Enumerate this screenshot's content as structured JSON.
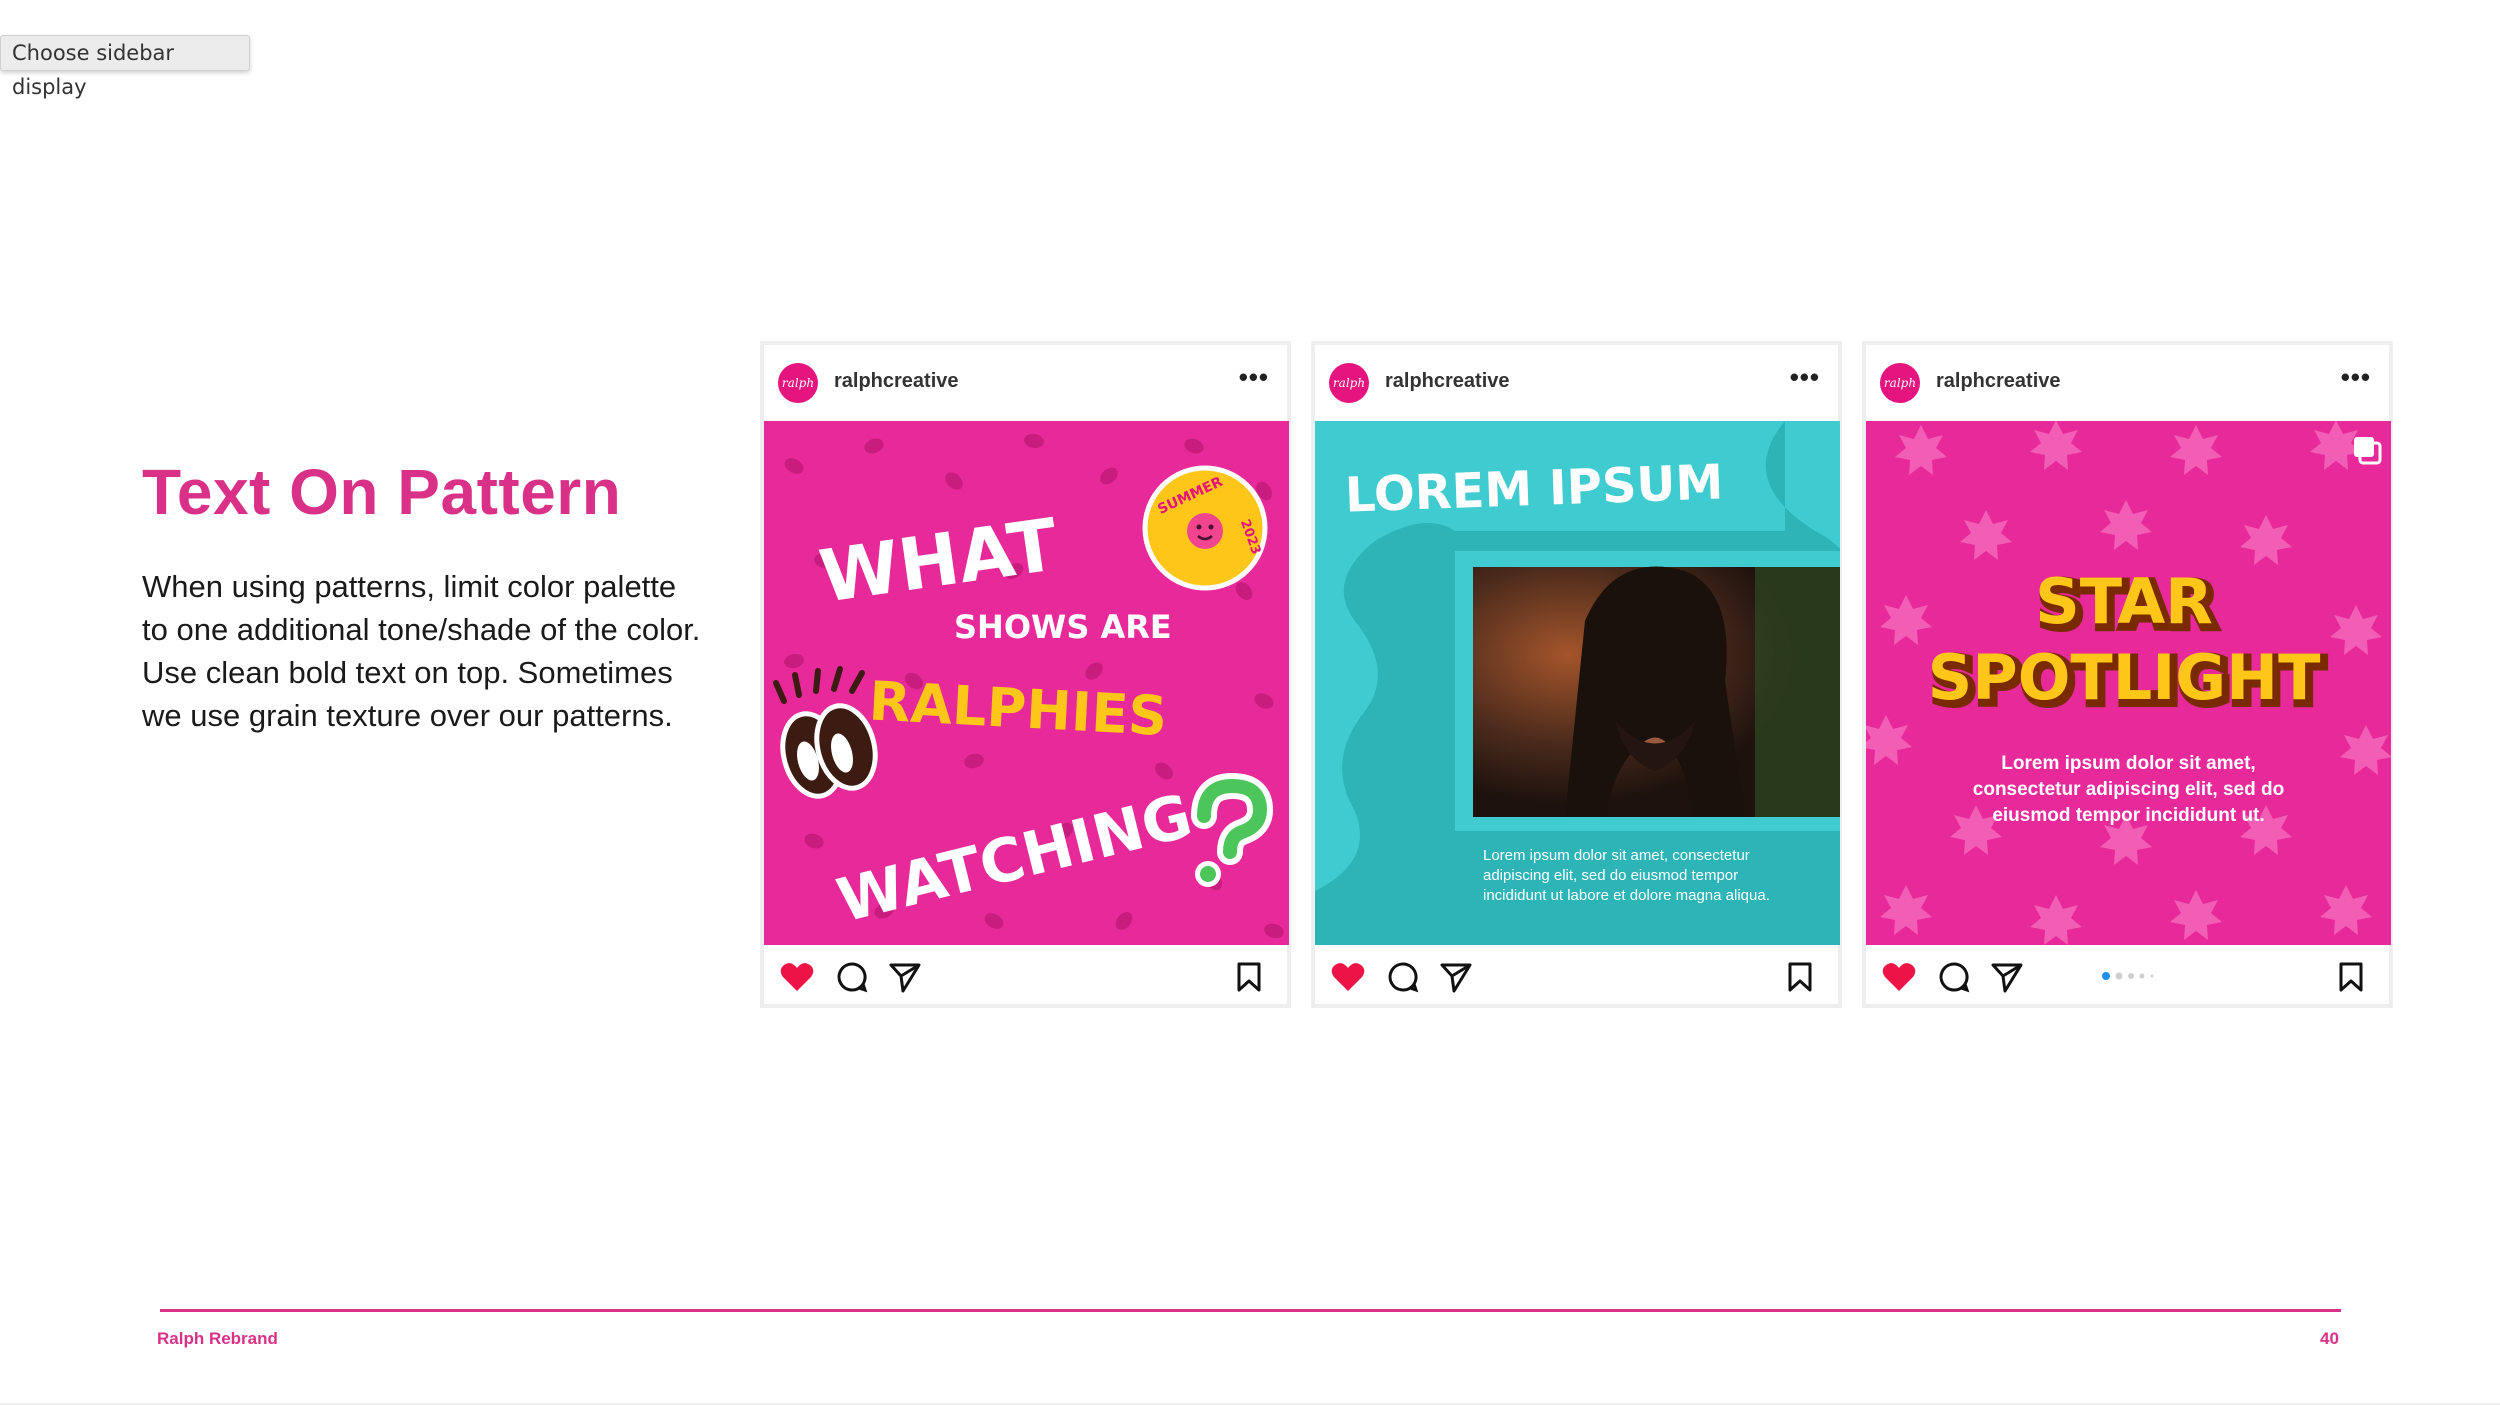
{
  "tooltip": "Choose sidebar display",
  "slide": {
    "heading": "Text On Pattern",
    "body": "When using patterns, limit color palette to one additional tone/shade of the color. Use clean bold text on top. Sometimes we use grain texture over our patterns."
  },
  "posts": [
    {
      "avatar_text": "ralph",
      "username": "ralphcreative",
      "more": "•••",
      "lines": [
        "WHAT",
        "SHOWS ARE",
        "RALPHIES",
        "WATCHING"
      ],
      "sticker": [
        "SUMMER",
        "2023"
      ]
    },
    {
      "avatar_text": "ralph",
      "username": "ralphcreative",
      "more": "•••",
      "title": "LOREM IPSUM",
      "caption": [
        "Lorem ipsum dolor sit amet, consectetur",
        "adipiscing elit, sed do eiusmod tempor",
        "incididunt ut labore et dolore magna aliqua."
      ]
    },
    {
      "avatar_text": "ralph",
      "username": "ralphcreative",
      "more": "•••",
      "title1": "STAR",
      "title2": "SPOTLIGHT",
      "caption": [
        "Lorem ipsum dolor sit amet,",
        "consectetur adipiscing elit, sed do",
        "eiusmod tempor incididunt ut."
      ]
    }
  ],
  "icons": {
    "like": "heart-icon",
    "comment": "comment-icon",
    "share": "send-icon",
    "save": "bookmark-icon"
  },
  "colors": {
    "brand_pink": "#d93188",
    "post_pink": "#e8299a",
    "teal": "#3fcbcf",
    "heart_red": "#ed1346",
    "yellow": "#ffc61a"
  },
  "footer": {
    "left": "Ralph Rebrand",
    "page_number": "40"
  }
}
